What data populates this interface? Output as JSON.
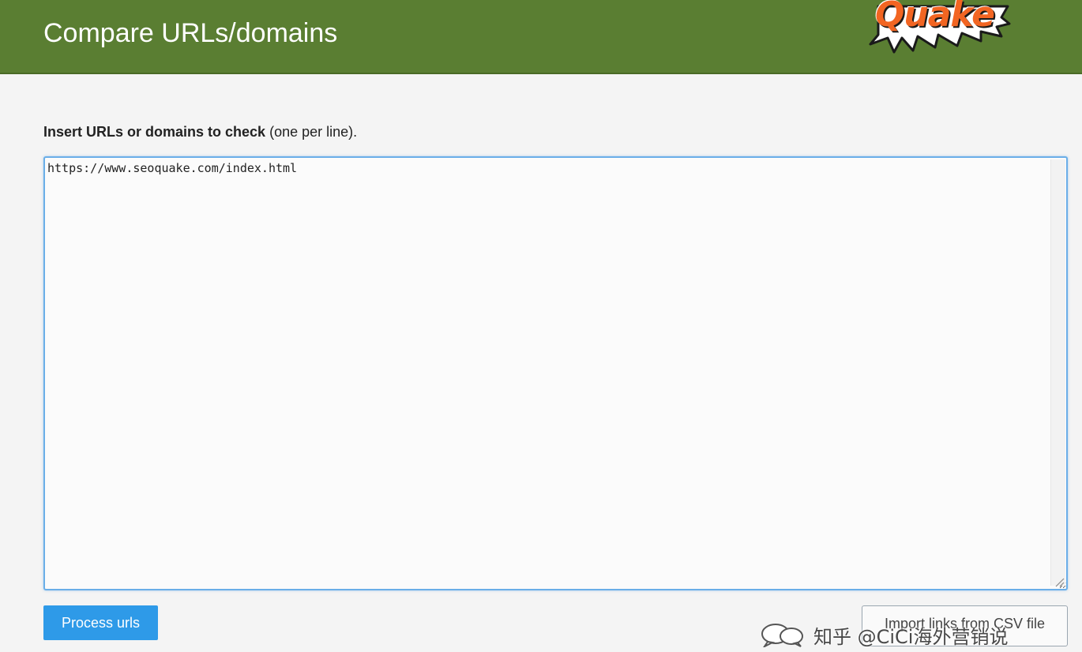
{
  "header": {
    "title": "Compare URLs/domains",
    "logo_text": "Quake",
    "background_color": "#5a7e32"
  },
  "form": {
    "instruction_bold": "Insert URLs or domains to check",
    "instruction_rest": " (one per line).",
    "textarea_value": "https://www.seoquake.com/index.html",
    "process_button_label": "Process urls",
    "import_button_label": "Import links from CSV file",
    "accent_color": "#2e9ae8"
  },
  "watermark": {
    "text": "知乎 @CiCi海外营销说",
    "icon": "chat-bubbles-icon"
  }
}
